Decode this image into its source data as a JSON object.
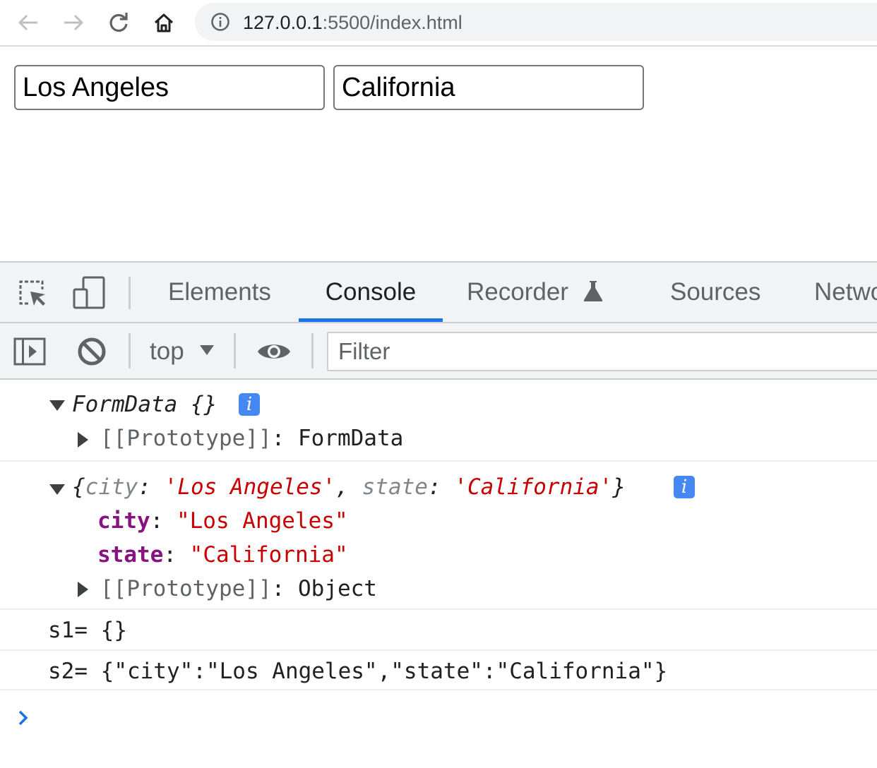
{
  "browser": {
    "url_host": "127.0.0.1",
    "url_rest": ":5500/index.html",
    "back_icon": "arrow-left-icon",
    "forward_icon": "arrow-right-icon",
    "reload_icon": "reload-icon",
    "home_icon": "home-icon",
    "info_icon": "info-circle-icon"
  },
  "page": {
    "city_value": "Los Angeles",
    "state_value": "California"
  },
  "devtools": {
    "tabs": [
      {
        "label": "Elements",
        "active": false
      },
      {
        "label": "Console",
        "active": true
      },
      {
        "label": "Recorder",
        "active": false
      },
      {
        "label": "Sources",
        "active": false
      },
      {
        "label": "Netwo",
        "active": false
      }
    ],
    "context": "top",
    "filter_placeholder": "Filter",
    "accent": "#1a73e8"
  },
  "console": {
    "msg1": {
      "summary": "FormData {}",
      "proto_key": "[[Prototype]]",
      "proto_value": "FormData"
    },
    "msg2": {
      "summary_open": "{",
      "k1": "city",
      "v1": "'Los Angeles'",
      "k2": "state",
      "v2": "'California'",
      "summary_close": "}",
      "city_key": "city",
      "city_val": "\"Los Angeles\"",
      "state_key": "state",
      "state_val": "\"California\"",
      "proto_key": "[[Prototype]]",
      "proto_value": "Object"
    },
    "msg3": "s1= {}",
    "msg4": "s2= {\"city\":\"Los Angeles\",\"state\":\"California\"}",
    "colors": {
      "string": "#c80000",
      "key": "#881280",
      "badge": "#4688f1"
    }
  }
}
